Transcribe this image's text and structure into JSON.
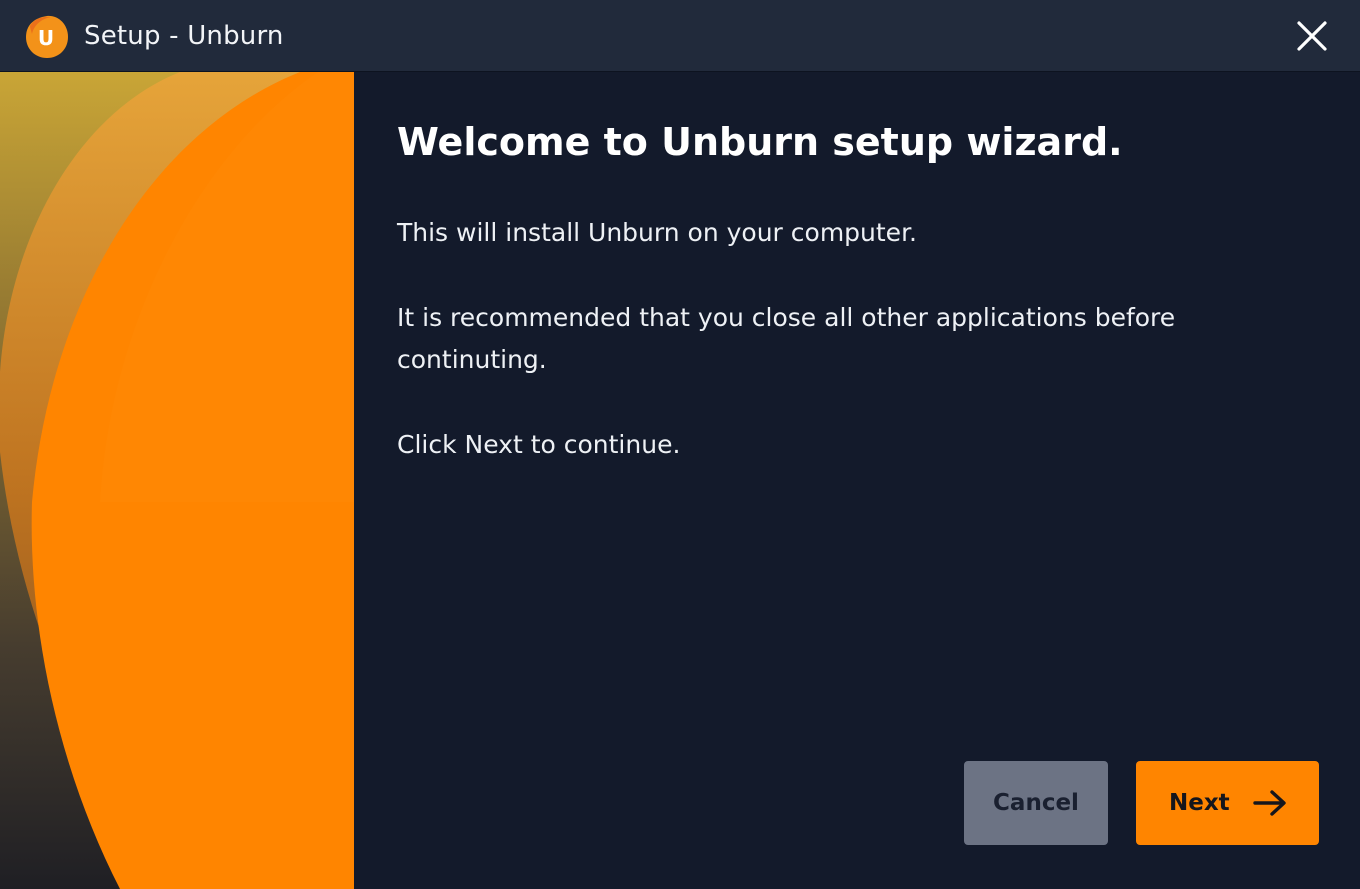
{
  "window": {
    "title": "Setup - Unburn",
    "app_icon_letter": "U",
    "app_icon": "unburn-logo-icon",
    "close_icon": "close-icon"
  },
  "colors": {
    "titlebar_bg": "#212a3b",
    "content_bg": "#131a2b",
    "accent": "#ff8500",
    "cancel_bg": "#6c7384"
  },
  "content": {
    "heading": "Welcome to Unburn setup wizard.",
    "paragraph_1": "This will install Unburn on your computer.",
    "paragraph_2": "It is recommended that you close all other applications before continuting.",
    "paragraph_3": "Click Next to continue."
  },
  "buttons": {
    "cancel_label": "Cancel",
    "next_label": "Next",
    "next_icon": "arrow-right-icon"
  }
}
